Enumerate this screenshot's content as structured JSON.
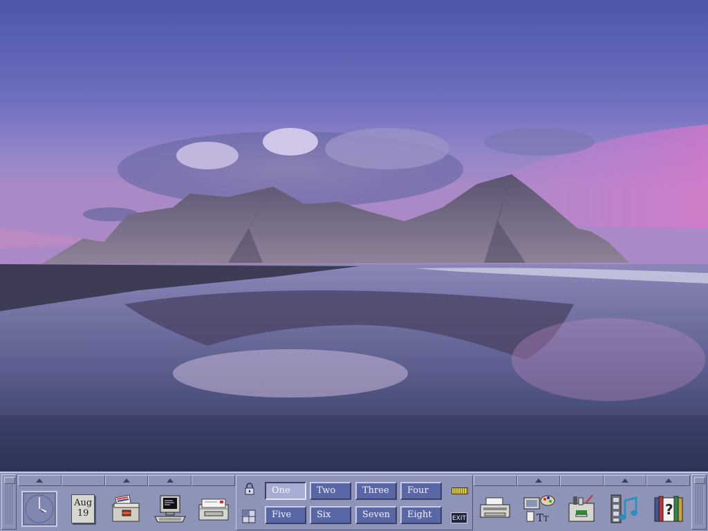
{
  "panel": {
    "date": {
      "month": "Aug",
      "day": "19"
    },
    "workspaces": [
      {
        "label": "One",
        "active": true
      },
      {
        "label": "Two",
        "active": false
      },
      {
        "label": "Three",
        "active": false
      },
      {
        "label": "Four",
        "active": false
      },
      {
        "label": "Five",
        "active": false
      },
      {
        "label": "Six",
        "active": false
      },
      {
        "label": "Seven",
        "active": false
      },
      {
        "label": "Eight",
        "active": false
      }
    ],
    "exit_label": "EXIT",
    "left_icons": [
      "clock-icon",
      "calendar-icon",
      "file-manager-icon",
      "terminal-icon",
      "mailer-icon"
    ],
    "right_icons": [
      "printer-icon",
      "style-manager-icon",
      "app-manager-icon",
      "media-player-icon",
      "help-manager-icon"
    ],
    "colors": {
      "panel": "#8e94b8",
      "workspace_button": "#5a67a7",
      "workspace_active": "#a6acd4",
      "light": "#c8cce4",
      "shadow": "#4d5274"
    }
  }
}
